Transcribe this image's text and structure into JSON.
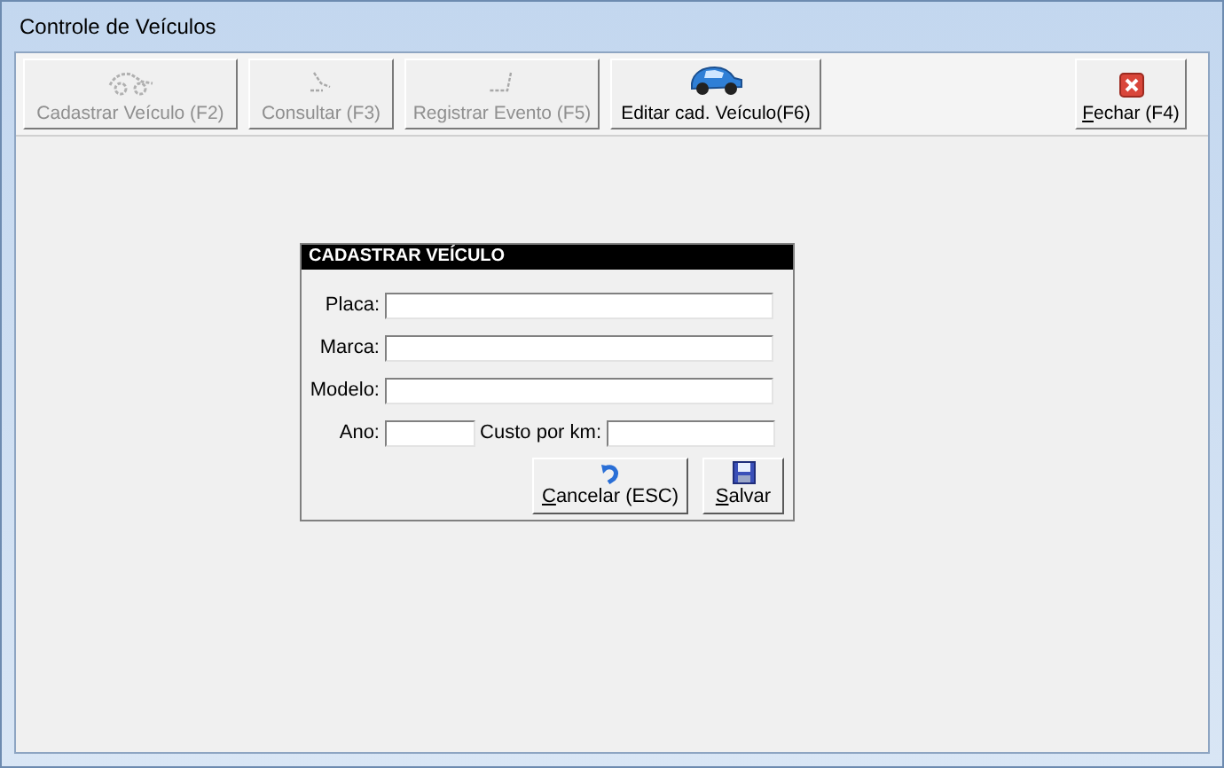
{
  "window": {
    "title": "Controle de Veículos"
  },
  "toolbar": [
    {
      "label": "Cadastrar Veículo (F2)",
      "kind": "car-sketch",
      "disabled": true,
      "underline_first": false
    },
    {
      "label": "Consultar (F3)",
      "kind": "magnifier-sketch",
      "disabled": true,
      "underline_first": false
    },
    {
      "label": "Registrar Evento (F5)",
      "kind": "pen-sketch",
      "disabled": true,
      "underline_first": false
    },
    {
      "label": "Editar cad. Veículo(F6)",
      "kind": "car",
      "disabled": false,
      "underline_first": false
    },
    {
      "label": "Fechar (F4)",
      "kind": "close",
      "disabled": false,
      "underline_first": true
    }
  ],
  "dialog": {
    "title": "CADASTRAR VEÍCULO",
    "fields": [
      {
        "label": "Placa:"
      },
      {
        "label": "Marca:"
      },
      {
        "label": "Modelo:"
      }
    ],
    "row": [
      {
        "label": "Ano:"
      },
      {
        "label": "Custo por km:"
      }
    ],
    "buttons": [
      {
        "label": "Cancelar (ESC)",
        "kind": "undo",
        "underline_first": true
      },
      {
        "label": "Salvar",
        "kind": "save",
        "underline_first": true
      }
    ]
  }
}
